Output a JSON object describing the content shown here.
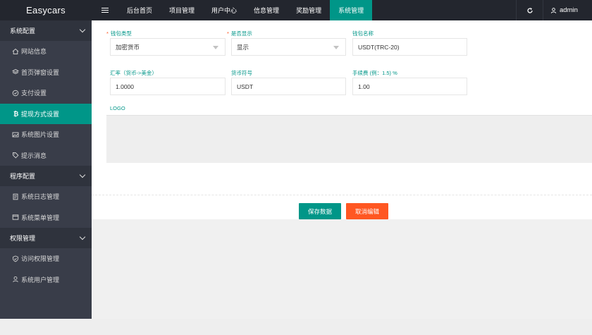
{
  "brand": "Easycars",
  "sidebar": {
    "groups": [
      {
        "label": "系统配置",
        "items": [
          {
            "label": "网站信息",
            "icon": "home-icon"
          },
          {
            "label": "首页弹窗设置",
            "icon": "layers-icon"
          },
          {
            "label": "支付设置",
            "icon": "shield-icon"
          },
          {
            "label": "提现方式设置",
            "icon": "bitcoin-icon",
            "active": true
          },
          {
            "label": "系统图片设置",
            "icon": "image-icon"
          },
          {
            "label": "提示消息",
            "icon": "tag-icon"
          }
        ]
      },
      {
        "label": "程序配置",
        "items": [
          {
            "label": "系统日志管理",
            "icon": "document-icon"
          },
          {
            "label": "系统菜单管理",
            "icon": "window-icon"
          }
        ]
      },
      {
        "label": "权限管理",
        "items": [
          {
            "label": "访问权限管理",
            "icon": "shield-check-icon"
          },
          {
            "label": "系统用户管理",
            "icon": "user-icon"
          }
        ]
      }
    ]
  },
  "topnav": {
    "items": [
      "后台首页",
      "项目管理",
      "用户中心",
      "信息管理",
      "奖励管理",
      "系统管理"
    ],
    "active_index": 5,
    "user": "admin"
  },
  "form": {
    "wallet_type": {
      "label": "钱包类型",
      "value": "加密货币"
    },
    "frontend_show": {
      "label": "是否显示",
      "value": "显示"
    },
    "wallet_name": {
      "label": "钱包名称",
      "value": "USDT(TRC-20)"
    },
    "exchange_rate": {
      "label": "汇率（货币->美金）",
      "value": "1.0000"
    },
    "currency_symbol": {
      "label": "货币符号",
      "value": "USDT"
    },
    "fee": {
      "label": "手续费 (例：1.5) %",
      "value": "1.00"
    },
    "logo_label": "LOGO",
    "save_label": "保存数据",
    "cancel_label": "取消编辑"
  },
  "colors": {
    "accent": "#009688",
    "danger": "#ff5722",
    "sidebar_bg": "#393d49",
    "topbar_bg": "#23262e"
  }
}
